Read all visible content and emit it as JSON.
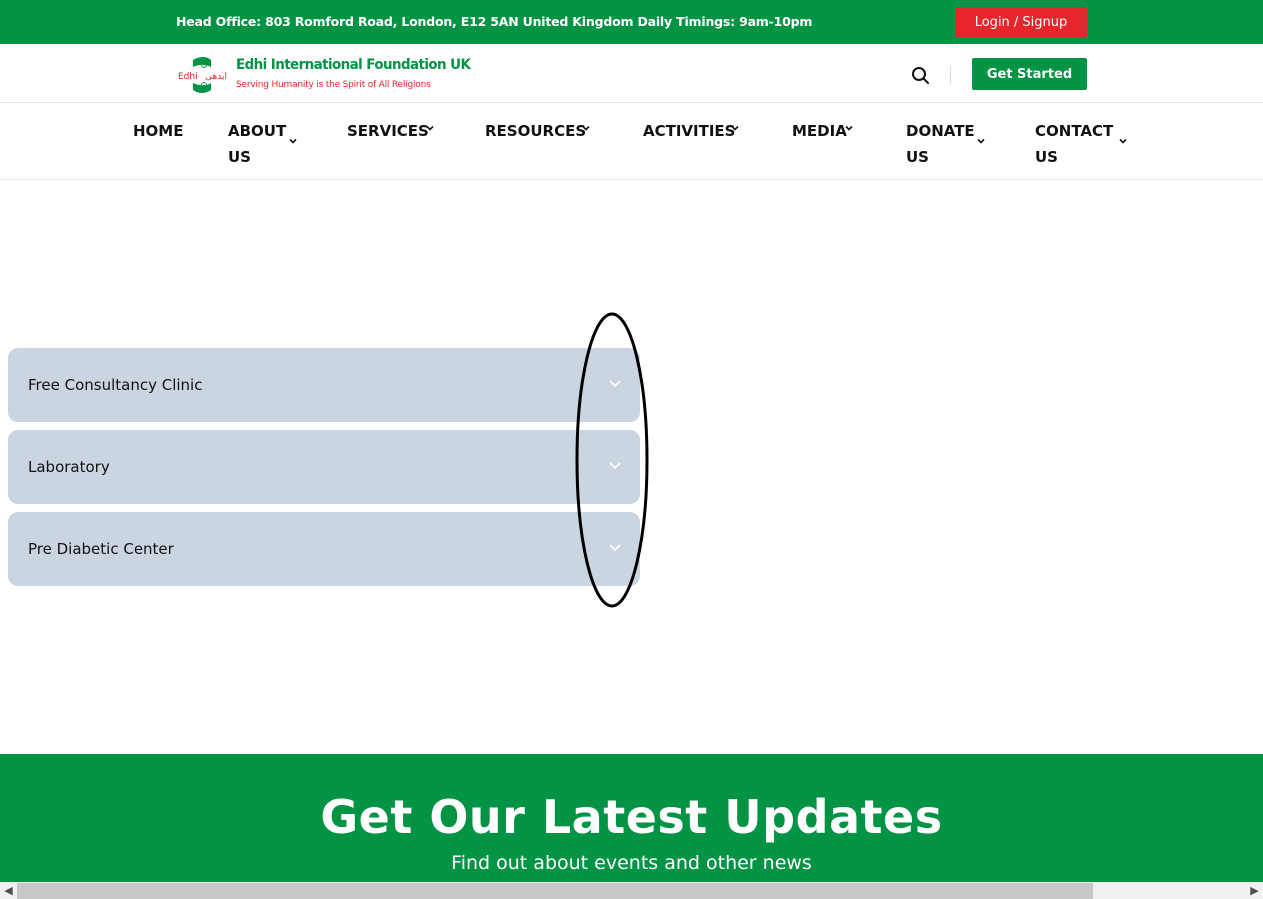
{
  "topbar": {
    "info": "Head Office: 803 Romford Road, London, E12 5AN United Kingdom Daily Timings: 9am-10pm",
    "login_label": "Login / Signup"
  },
  "header": {
    "logo_name": "Edhi International Foundation UK",
    "logo_tagline": "Serving Humanity is the Spirit of All Religions",
    "search_icon": "search-icon",
    "get_started_label": "Get Started"
  },
  "nav": {
    "items": [
      {
        "line1": "HOME",
        "line2": "",
        "has_menu": false
      },
      {
        "line1": "ABOUT",
        "line2": "US",
        "has_menu": true
      },
      {
        "line1": "SERVICES",
        "line2": "",
        "has_menu": true
      },
      {
        "line1": "RESOURCES",
        "line2": "",
        "has_menu": true
      },
      {
        "line1": "ACTIVITIES",
        "line2": "",
        "has_menu": true
      },
      {
        "line1": "MEDIA",
        "line2": "",
        "has_menu": true
      },
      {
        "line1": "DONATE",
        "line2": "US",
        "has_menu": true
      },
      {
        "line1": "CONTACT",
        "line2": "US",
        "has_menu": true
      }
    ]
  },
  "accordion": {
    "items": [
      {
        "label": "Free Consultancy Clinic",
        "icon": "chevron-down-icon"
      },
      {
        "label": "Laboratory",
        "icon": "chevron-down-icon"
      },
      {
        "label": "Pre Diabetic Center",
        "icon": "chevron-down-icon"
      }
    ]
  },
  "updates": {
    "title": "Get Our Latest Updates",
    "subtitle": "Find out about events and other news"
  },
  "colors": {
    "brand_green": "#029444",
    "brand_red": "#e6262c",
    "accordion_bg": "#cbd5e1"
  }
}
